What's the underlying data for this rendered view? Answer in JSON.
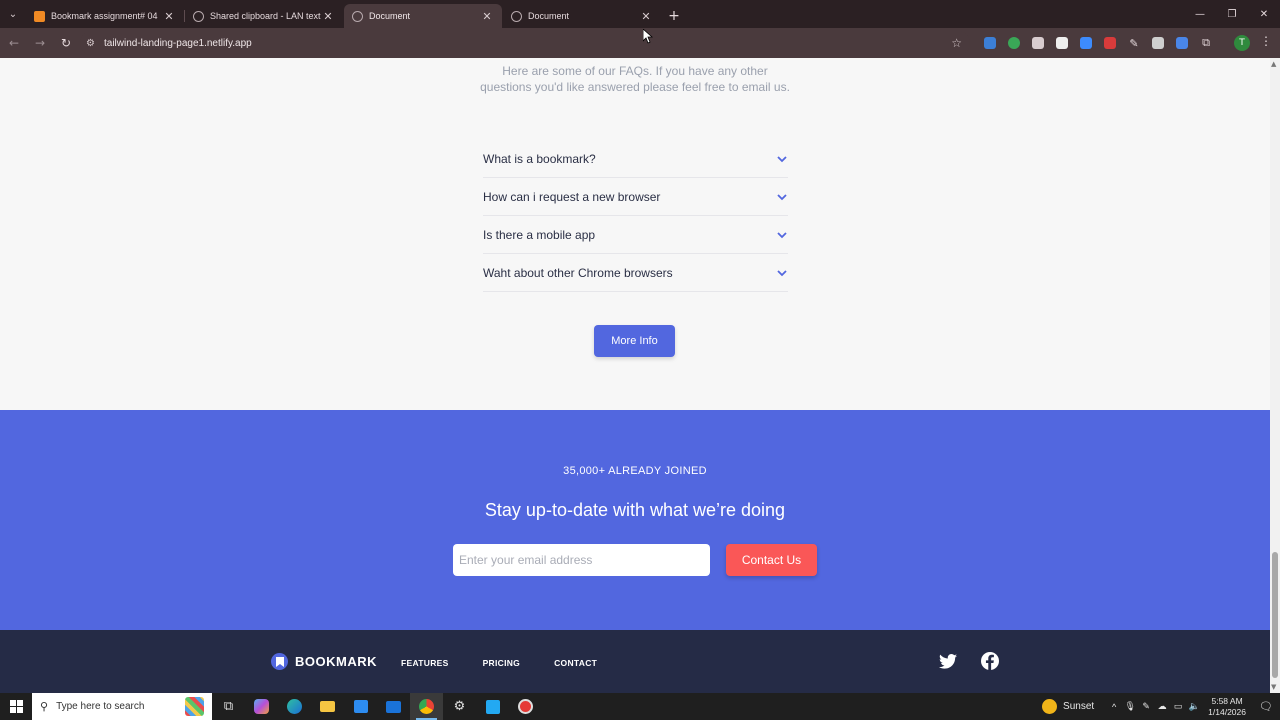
{
  "browser": {
    "tabs": [
      {
        "title": "Bookmark assignment# 04",
        "favicon": "orange-square-icon",
        "active": false
      },
      {
        "title": "Shared clipboard - LAN text sh",
        "favicon": "globe-icon",
        "active": false
      },
      {
        "title": "Document",
        "favicon": "globe-icon",
        "active": true
      },
      {
        "title": "Document",
        "favicon": "globe-icon",
        "active": false
      }
    ],
    "url": "tailwind-landing-page1.netlify.app",
    "profile_initial": "T"
  },
  "page": {
    "faq_intro": "Here are some of our FAQs. If you have any other questions you'd like answered please feel free to email us.",
    "faqs": [
      {
        "question": "What is a bookmark?"
      },
      {
        "question": "How can i request a new browser"
      },
      {
        "question": "Is there a mobile app"
      },
      {
        "question": "Waht about other Chrome browsers"
      }
    ],
    "more_info_label": "More Info",
    "newsletter": {
      "joined": "35,000+ ALREADY JOINED",
      "heading": "Stay up-to-date with what we’re doing",
      "email_placeholder": "Enter your email address",
      "contact_label": "Contact Us"
    },
    "footer": {
      "brand": "BOOKMARK",
      "links": [
        "FEATURES",
        "PRICING",
        "CONTACT"
      ]
    }
  },
  "colors": {
    "primary": "#5267df",
    "accent": "#fa5757",
    "footer_bg": "#252b46",
    "text_dark": "#2a2f45",
    "text_muted": "#9aa0ad"
  },
  "taskbar": {
    "search_placeholder": "Type here to search",
    "weather": "Sunset",
    "time": "5:58 AM",
    "date": "1/14/2026"
  }
}
